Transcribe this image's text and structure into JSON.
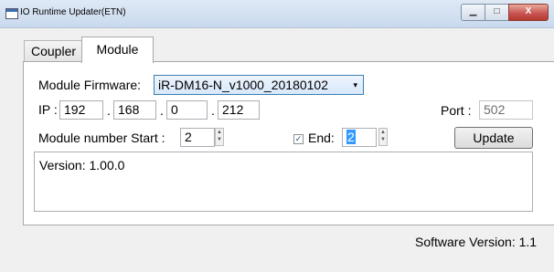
{
  "window": {
    "title": "IO Runtime Updater(ETN)",
    "close": "X",
    "minimize": "▁",
    "maximize": "□"
  },
  "tabs": {
    "coupler": "Coupler",
    "module": "Module"
  },
  "firmware": {
    "label": "Module Firmware:",
    "value": "iR-DM16-N_v1000_20180102",
    "arrow": "▾"
  },
  "ip": {
    "label": "IP :",
    "oct1": "192",
    "oct2": "168",
    "oct3": "0",
    "oct4": "212",
    "sep": "."
  },
  "port": {
    "label": "Port :",
    "value": "502"
  },
  "module_number": {
    "start_label": "Module number Start :",
    "start_value": "2",
    "end_checked": "✓",
    "end_label": "End:",
    "end_value": "2"
  },
  "update_button": "Update",
  "output": {
    "text": "Version: 1.00.0"
  },
  "footer": {
    "software_version": "Software Version: 1.1"
  },
  "colors": {
    "titlebar": "#c9d9ee",
    "combo_border": "#3c7fb1",
    "selection": "#3399ff",
    "close_button": "#c75050"
  }
}
